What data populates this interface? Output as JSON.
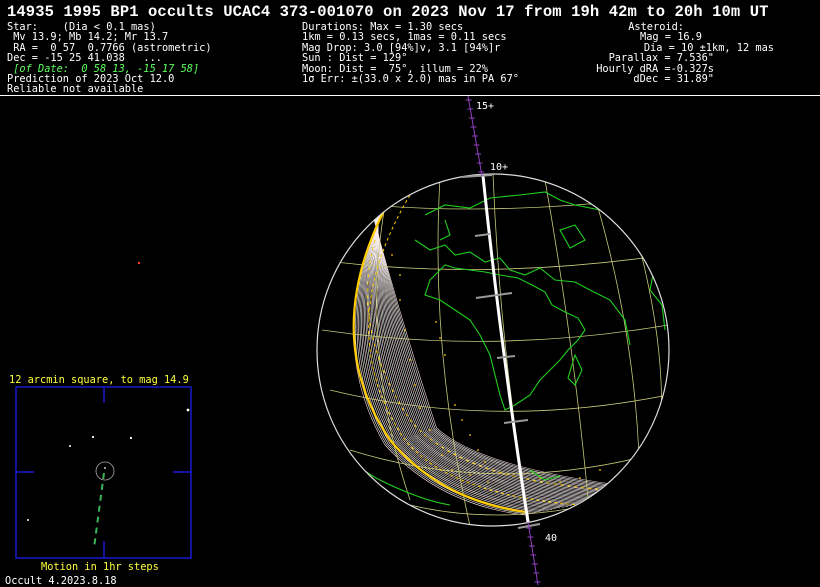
{
  "header": {
    "title": "14935 1995 BP1 occults UCAC4 373-001070 on 2023 Nov 17 from 19h 42m to 20h 10m UT"
  },
  "star": {
    "line1": "Star:    (Dia < 0.1 mas)",
    "line2": " Mv 13.9; Mb 14.2; Mr 13.7",
    "line3": " RA =  0 57  0.7766 (astrometric)",
    "line4": "Dec = -15 25 41.038   ...",
    "line5": " [of Date:  0 58 13, -15 17 58]",
    "line6": "Prediction of 2023 Oct 12.0",
    "line7": "Reliable not available"
  },
  "event": {
    "line1": "Durations: Max = 1.30 secs",
    "line2": "1km = 0.13 secs, 1mas = 0.11 secs",
    "line3": "Mag Drop: 3.0 [94%]v, 3.1 [94%]r",
    "line4": "Sun : Dist = 129°",
    "line5": "Moon: Dist =  75°, illum = 22%",
    "line6": "1σ Err: ±(33.0 x 2.0) mas in PA 67°"
  },
  "asteroid": {
    "line1": "Asteroid:",
    "line2": "Mag = 16.9",
    "line3": "Dia = 10 ±1km, 12 mas",
    "line4": "Parallax = 7.536\"",
    "line5": "Hourly dRA =-0.327s",
    "line6": "dDec = 31.89\""
  },
  "map": {
    "tick_labels": [
      "15+",
      "10+",
      "40"
    ]
  },
  "finder": {
    "title": "12 arcmin square, to mag 14.9",
    "caption": "Motion in 1hr steps"
  },
  "footer": {
    "version": "Occult 4.2023.8.18"
  },
  "colors": {
    "coastline": "#20d020",
    "grid": "#c8c878",
    "limb": "#ffcc00",
    "path": "#ffffff",
    "track": "#9040c0",
    "finder_frame": "#2020ff",
    "caption": "#ffff3a"
  }
}
